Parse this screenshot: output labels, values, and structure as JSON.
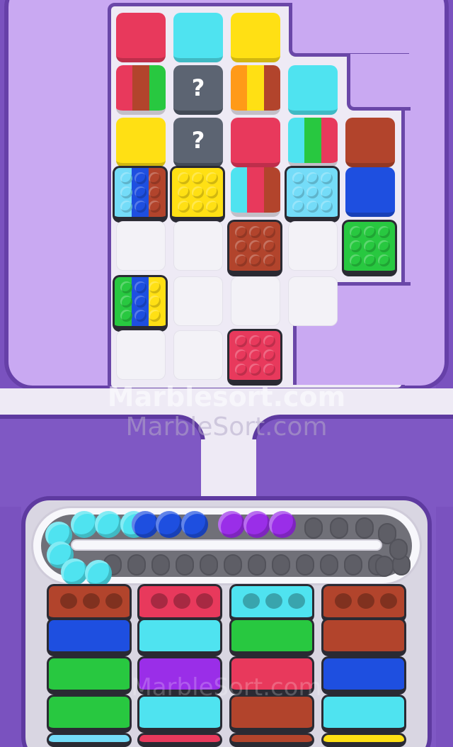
{
  "game": {
    "watermark_main": "Marblesort.com",
    "watermark_sub": "MarbleSort.com",
    "watermark_tray": "MarbleSort.com",
    "unknown_glyph": "?"
  },
  "colors": {
    "red": "#e8395c",
    "cyan": "#4fe3f0",
    "yellow": "#ffe014",
    "brown": "#b2442c",
    "green": "#28c840",
    "blue": "#1e4fe0",
    "orange": "#ff9a18",
    "purple": "#9a2ee8",
    "skyblue": "#74dcf8",
    "gray": "#5c6472"
  },
  "board": {
    "tiles": [
      {
        "row": 0,
        "col": 0,
        "type": "solid",
        "colors": [
          "red"
        ]
      },
      {
        "row": 0,
        "col": 1,
        "type": "solid",
        "colors": [
          "cyan"
        ]
      },
      {
        "row": 0,
        "col": 2,
        "type": "solid",
        "colors": [
          "yellow"
        ]
      },
      {
        "row": 1,
        "col": 0,
        "type": "striped",
        "colors": [
          "red",
          "brown",
          "green"
        ]
      },
      {
        "row": 1,
        "col": 1,
        "type": "unknown",
        "colors": [
          "gray"
        ]
      },
      {
        "row": 1,
        "col": 2,
        "type": "striped",
        "colors": [
          "orange",
          "yellow",
          "brown"
        ]
      },
      {
        "row": 1,
        "col": 3,
        "type": "solid",
        "colors": [
          "cyan"
        ]
      },
      {
        "row": 2,
        "col": 0,
        "type": "solid",
        "colors": [
          "yellow"
        ]
      },
      {
        "row": 2,
        "col": 1,
        "type": "unknown",
        "colors": [
          "gray"
        ]
      },
      {
        "row": 2,
        "col": 2,
        "type": "solid",
        "colors": [
          "red"
        ]
      },
      {
        "row": 2,
        "col": 3,
        "type": "striped",
        "colors": [
          "cyan",
          "green",
          "red"
        ]
      },
      {
        "row": 2,
        "col": 4,
        "type": "solid",
        "colors": [
          "brown"
        ]
      },
      {
        "row": 3,
        "col": 0,
        "type": "box",
        "colors": [
          "skyblue",
          "blue",
          "brown"
        ]
      },
      {
        "row": 3,
        "col": 1,
        "type": "box",
        "colors": [
          "yellow"
        ]
      },
      {
        "row": 3,
        "col": 2,
        "type": "striped",
        "colors": [
          "cyan",
          "red",
          "brown"
        ]
      },
      {
        "row": 3,
        "col": 3,
        "type": "box",
        "colors": [
          "skyblue"
        ]
      },
      {
        "row": 3,
        "col": 4,
        "type": "solid",
        "colors": [
          "blue"
        ]
      },
      {
        "row": 4,
        "col": 0,
        "type": "empty",
        "colors": []
      },
      {
        "row": 4,
        "col": 1,
        "type": "empty",
        "colors": []
      },
      {
        "row": 4,
        "col": 2,
        "type": "box",
        "colors": [
          "brown"
        ]
      },
      {
        "row": 4,
        "col": 3,
        "type": "empty",
        "colors": []
      },
      {
        "row": 4,
        "col": 4,
        "type": "box",
        "colors": [
          "green"
        ]
      },
      {
        "row": 5,
        "col": 0,
        "type": "box",
        "colors": [
          "green",
          "blue",
          "yellow"
        ]
      },
      {
        "row": 5,
        "col": 1,
        "type": "empty",
        "colors": []
      },
      {
        "row": 5,
        "col": 2,
        "type": "empty",
        "colors": []
      },
      {
        "row": 5,
        "col": 3,
        "type": "empty",
        "colors": []
      },
      {
        "row": 6,
        "col": 0,
        "type": "empty",
        "colors": []
      },
      {
        "row": 6,
        "col": 1,
        "type": "empty",
        "colors": []
      },
      {
        "row": 6,
        "col": 2,
        "type": "box",
        "colors": [
          "red"
        ]
      }
    ]
  },
  "belt": {
    "marbles": [
      "cyan",
      "cyan",
      "cyan",
      "cyan",
      "cyan",
      "cyan",
      "cyan",
      "blue",
      "blue",
      "blue",
      "purple",
      "purple",
      "purple"
    ],
    "empty_slots": 20
  },
  "crates": {
    "columns": [
      [
        "brown",
        "blue",
        "green",
        "green"
      ],
      [
        "red",
        "cyan",
        "purple",
        "cyan"
      ],
      [
        "cyan",
        "green",
        "red",
        "brown"
      ],
      [
        "brown",
        "brown",
        "blue",
        "cyan"
      ]
    ]
  }
}
